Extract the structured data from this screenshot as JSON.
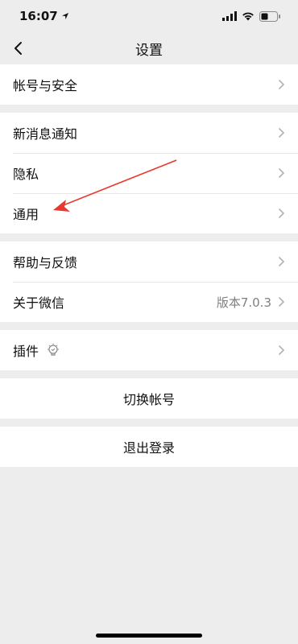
{
  "status": {
    "time": "16:07"
  },
  "nav": {
    "title": "设置"
  },
  "groups": {
    "account": {
      "security": "帐号与安全"
    },
    "general": {
      "notifications": "新消息通知",
      "privacy": "隐私",
      "general": "通用"
    },
    "about": {
      "help": "帮助与反馈",
      "about_wechat": "关于微信",
      "version": "版本7.0.3"
    },
    "plugins": {
      "label": "插件"
    },
    "switch": {
      "label": "切换帐号"
    },
    "logout": {
      "label": "退出登录"
    }
  },
  "colors": {
    "background": "#ededed",
    "arrow": "#e8392f"
  }
}
